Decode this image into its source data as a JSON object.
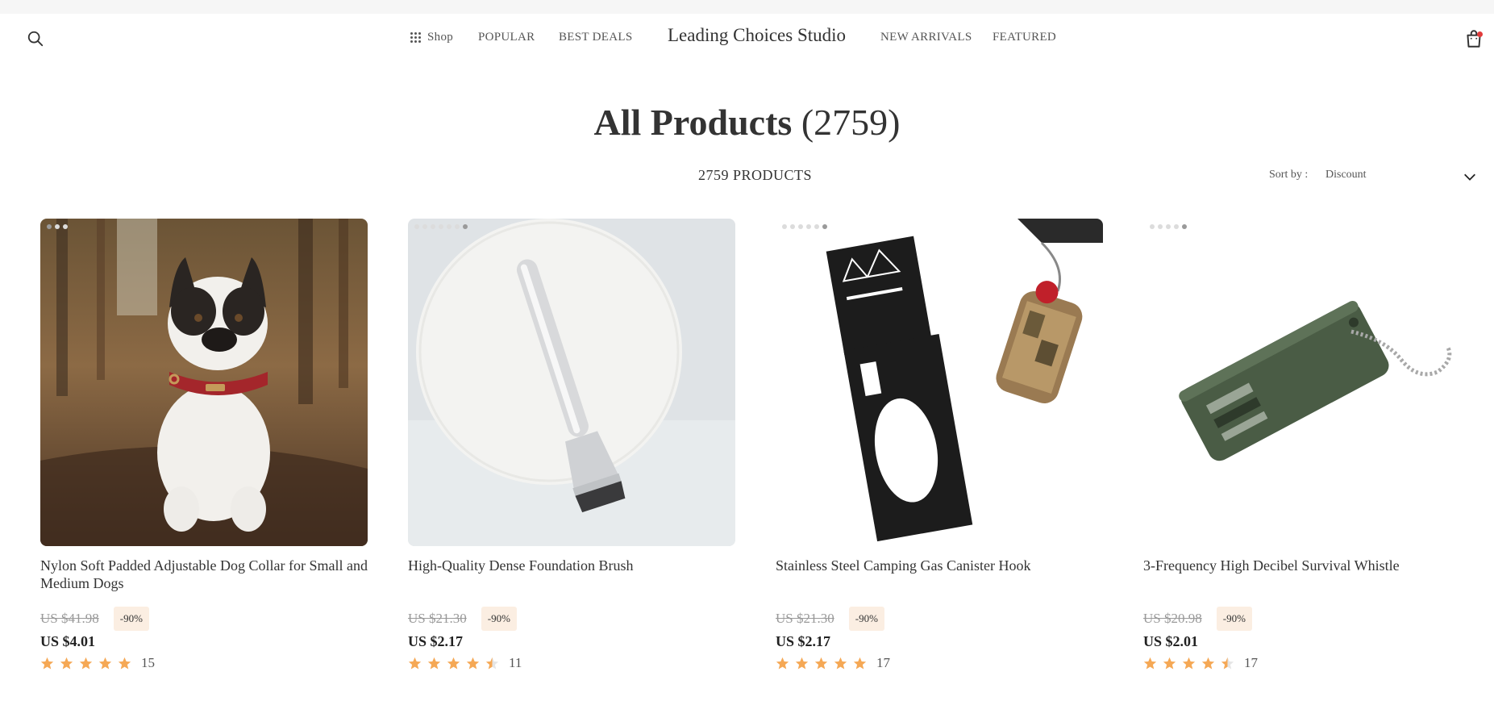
{
  "header": {
    "brand": "Leading Choices Studio",
    "nav": {
      "shop": "Shop",
      "popular": "POPULAR",
      "best_deals": "BEST DEALS",
      "new_arrivals": "NEW ARRIVALS",
      "featured": "FEATURED"
    },
    "icons": {
      "search": "search-icon",
      "cart": "shopping-bag-icon",
      "shop_menu": "grid-icon"
    },
    "cart_indicator_color": "#e23b3b"
  },
  "page": {
    "title": "All Products",
    "title_count": "(2759)",
    "products_count": "2759 PRODUCTS",
    "sort_label": "Sort by :",
    "sort_value": "Discount"
  },
  "colors": {
    "badge_bg": "#fbeee2",
    "star": "#f5a855"
  },
  "products": [
    {
      "name": "Nylon Soft Padded Adjustable Dog Collar for Small and Medium Dogs",
      "old_price": "US $41.98",
      "discount": "-90%",
      "price": "US $4.01",
      "rating": 5,
      "reviews": "15",
      "image": "french-bulldog-red-collar-forest"
    },
    {
      "name": "High-Quality Dense Foundation Brush",
      "old_price": "US $21.30",
      "discount": "-90%",
      "price": "US $2.17",
      "rating": 4.5,
      "reviews": "11",
      "image": "silver-foundation-brush"
    },
    {
      "name": "Stainless Steel Camping Gas Canister Hook",
      "old_price": "US $21.30",
      "discount": "-90%",
      "price": "US $2.17",
      "rating": 5,
      "reviews": "17",
      "image": "black-camping-hook-gas-canister"
    },
    {
      "name": "3-Frequency High Decibel Survival Whistle",
      "old_price": "US $20.98",
      "discount": "-90%",
      "price": "US $2.01",
      "rating": 4.5,
      "reviews": "17",
      "image": "green-survival-whistle-chain"
    }
  ]
}
